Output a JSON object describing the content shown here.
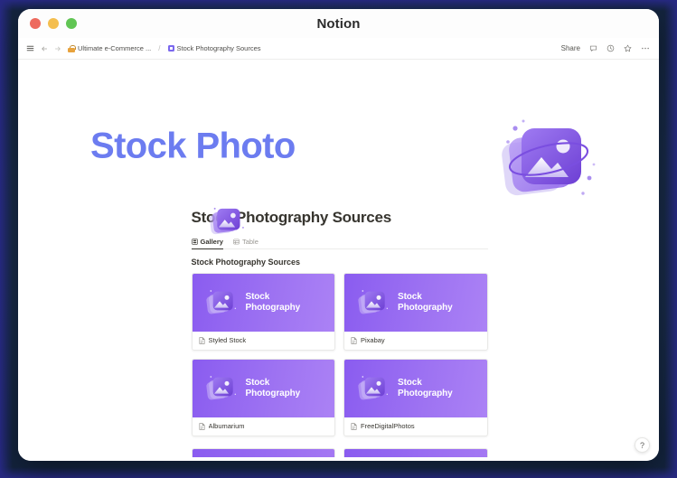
{
  "window": {
    "title": "Notion",
    "traffic_lights": [
      {
        "name": "close",
        "color": "#ed6a5e"
      },
      {
        "name": "minimize",
        "color": "#f4be4f"
      },
      {
        "name": "maximize",
        "color": "#61c554"
      }
    ]
  },
  "toolbar": {
    "menu_icon": "hamburger-menu-icon",
    "back_icon": "back-arrow-icon",
    "forward_icon": "forward-arrow-icon",
    "breadcrumb": [
      {
        "icon": "lock-emoji-icon",
        "label": "Ultimate e-Commerce ..."
      },
      {
        "icon": "page-square-icon",
        "label": "Stock Photography Sources"
      }
    ],
    "separator": "/",
    "share_label": "Share",
    "comment_icon": "comment-bubble-icon",
    "history_icon": "clock-history-icon",
    "favorite_icon": "star-icon",
    "more_icon": "more-horizontal-icon"
  },
  "hero": {
    "title": "Stock Photo",
    "title_color": "#6c7cf0",
    "art_icon": "stock-photo-3d-icon",
    "small_art_icon": "stock-photo-3d-icon-small"
  },
  "database": {
    "title": "Stock Photography Sources",
    "views": [
      {
        "label": "Gallery",
        "icon": "gallery-view-icon",
        "active": true
      },
      {
        "label": "Table",
        "icon": "table-view-icon",
        "active": false
      }
    ],
    "group_title": "Stock Photography Sources",
    "cover_text_line1": "Stock",
    "cover_text_line2": "Photography",
    "cover_gradient": [
      "#8a5cf0",
      "#ab82f5"
    ],
    "cards": [
      {
        "name": "Styled Stock",
        "icon": "page-doc-icon"
      },
      {
        "name": "Pixabay",
        "icon": "page-doc-icon"
      },
      {
        "name": "Albumarium",
        "icon": "page-doc-icon"
      },
      {
        "name": "FreeDigitalPhotos",
        "icon": "page-doc-icon"
      }
    ]
  },
  "help": {
    "label": "?"
  }
}
